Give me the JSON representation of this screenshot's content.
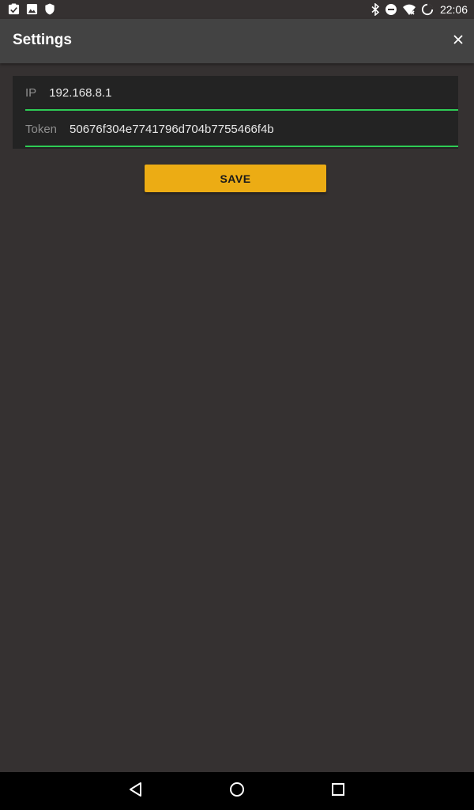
{
  "status_bar": {
    "time": "22:06",
    "left_icons": [
      "task-check-icon",
      "image-icon",
      "shield-icon"
    ],
    "right_icons": [
      "bluetooth-icon",
      "do-not-disturb-icon",
      "wifi-off-icon",
      "battery-icon"
    ]
  },
  "app_bar": {
    "title": "Settings",
    "close_icon": "close-icon"
  },
  "form": {
    "ip": {
      "label": "IP",
      "value": "192.168.8.1"
    },
    "token": {
      "label": "Token",
      "value": "50676f304e7741796d704b7755466f4b"
    }
  },
  "save_label": "SAVE",
  "navigation": {
    "icons": [
      "back-icon",
      "home-icon",
      "recents-icon"
    ]
  },
  "colors": {
    "background": "#353131",
    "app_bar": "#434343",
    "card": "#232323",
    "accent_underline": "#2ecc55",
    "button": "#ecac14",
    "nav_bar": "#000000"
  }
}
